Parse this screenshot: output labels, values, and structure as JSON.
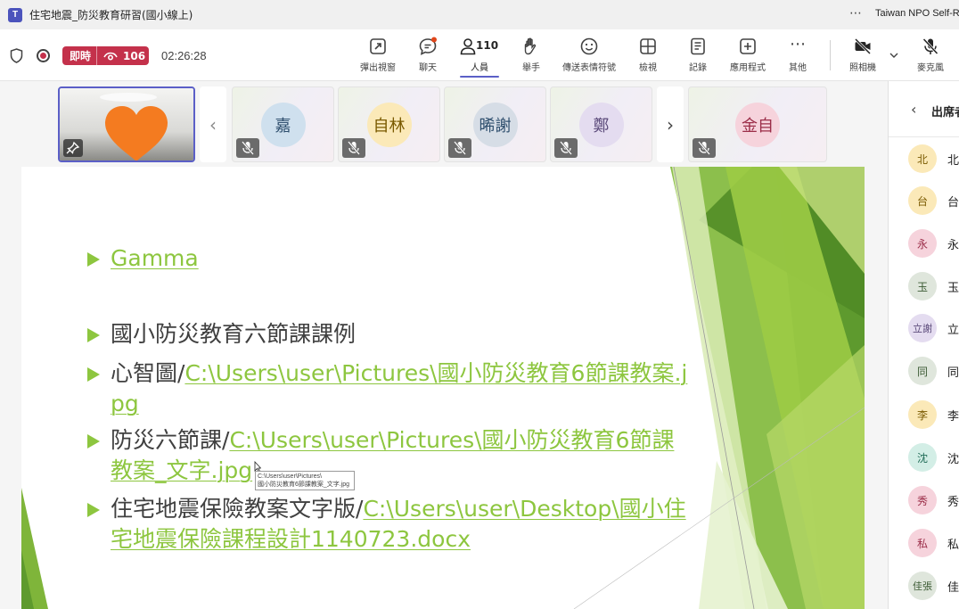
{
  "window": {
    "app_icon": "T",
    "title": "住宅地震_防災教育研習(國小線上)",
    "more_icon": "⋯",
    "org": "Taiwan NPO Self-R"
  },
  "toolbar": {
    "live_label": "即時",
    "viewers": "106",
    "timer": "02:26:28",
    "buttons": [
      {
        "id": "popout",
        "label": "彈出視窗",
        "icon": "popout-icon"
      },
      {
        "id": "chat",
        "label": "聊天",
        "icon": "chat-icon"
      },
      {
        "id": "people",
        "label": "人員",
        "icon": "people-icon",
        "count": "110"
      },
      {
        "id": "raise",
        "label": "舉手",
        "icon": "hand-icon"
      },
      {
        "id": "react",
        "label": "傳送表情符號",
        "icon": "emoji-icon"
      },
      {
        "id": "view",
        "label": "檢視",
        "icon": "grid-icon"
      },
      {
        "id": "notes",
        "label": "記錄",
        "icon": "notes-icon"
      },
      {
        "id": "apps",
        "label": "應用程式",
        "icon": "apps-icon"
      },
      {
        "id": "more",
        "label": "其他",
        "icon": "more-icon",
        "glyph": "⋯"
      },
      {
        "id": "camera",
        "label": "照相機",
        "icon": "camera-off-icon"
      },
      {
        "id": "mic",
        "label": "麥克風",
        "icon": "mic-off-icon"
      }
    ]
  },
  "gallery": {
    "participants": [
      {
        "initials": "嘉",
        "bg": "#cfe0ee",
        "fg": "#2f4f6e"
      },
      {
        "initials": "自林",
        "bg": "#fbe9b8",
        "fg": "#7a5a00"
      },
      {
        "initials": "晞謝",
        "bg": "#d6dde6",
        "fg": "#2f4f6e"
      },
      {
        "initials": "鄭",
        "bg": "#e4dcf0",
        "fg": "#5b4a7a"
      },
      {
        "initials": "金自",
        "bg": "#f6d3dc",
        "fg": "#9b2d48"
      }
    ],
    "prev_glyph": "‹",
    "next_glyph": "›"
  },
  "slide": {
    "bullets": [
      {
        "prefix": "",
        "link": "Gamma"
      },
      {
        "prefix": "國小防災教育六節課課例",
        "link": ""
      },
      {
        "prefix": "心智圖/",
        "link": "C:\\Users\\user\\Pictures\\國小防災教育6節課教案.jpg"
      },
      {
        "prefix": "防災六節課/",
        "link": "C:\\Users\\user\\Pictures\\國小防災教育6節課教案_文字.jpg"
      },
      {
        "prefix": "住宅地震保險教案文字版/",
        "link": "C:\\Users\\user\\Desktop\\國小住宅地震保險課程設計1140723.docx"
      }
    ],
    "tooltip_line1": "C:\\Users\\user\\Pictures\\",
    "tooltip_line2": "國小防災教育6節課教案_文字.jpg",
    "accent": "#8dc63f"
  },
  "panel": {
    "title": "出席者",
    "back_glyph": "‹",
    "people": [
      {
        "initials": "北",
        "name": "北",
        "bg": "#fbe9b8",
        "fg": "#7a5a00"
      },
      {
        "initials": "台",
        "name": "台",
        "bg": "#fbe9b8",
        "fg": "#7a5a00"
      },
      {
        "initials": "永",
        "name": "永",
        "bg": "#f6d3dc",
        "fg": "#9b2d48"
      },
      {
        "initials": "玉",
        "name": "玉",
        "bg": "#dfe6dc",
        "fg": "#3b5a33"
      },
      {
        "initials": "立謝",
        "name": "立",
        "bg": "#e4dcf0",
        "fg": "#5b4a7a"
      },
      {
        "initials": "同",
        "name": "同",
        "bg": "#dfe6dc",
        "fg": "#3b5a33"
      },
      {
        "initials": "李",
        "name": "李",
        "bg": "#fbe9b8",
        "fg": "#7a5a00"
      },
      {
        "initials": "沈",
        "name": "沈",
        "bg": "#d3eee6",
        "fg": "#1f6b56"
      },
      {
        "initials": "秀",
        "name": "秀",
        "bg": "#f6d3dc",
        "fg": "#9b2d48"
      },
      {
        "initials": "私",
        "name": "私",
        "bg": "#f6d3dc",
        "fg": "#9b2d48"
      },
      {
        "initials": "佳張",
        "name": "佳",
        "bg": "#dfe6dc",
        "fg": "#3b5a33"
      }
    ]
  }
}
